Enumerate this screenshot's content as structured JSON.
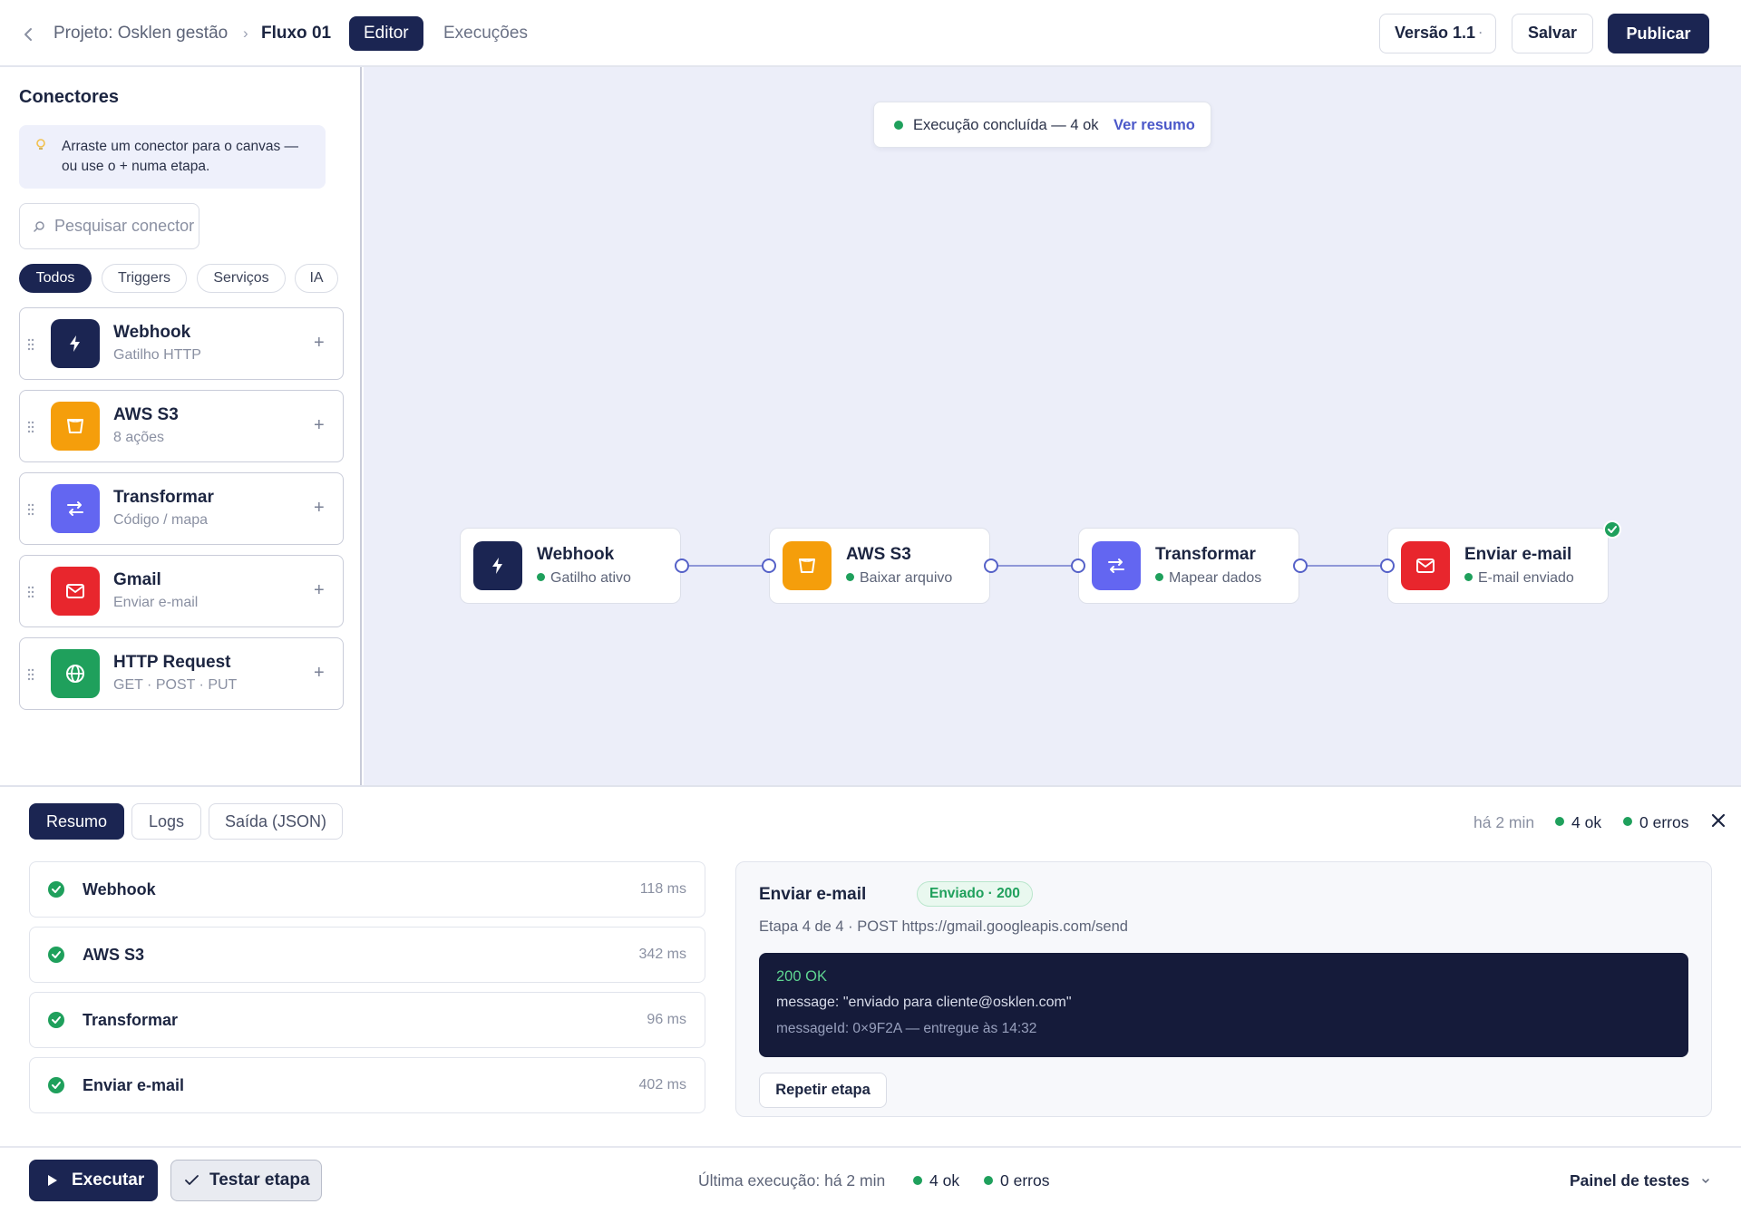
{
  "topbar": {
    "breadcrumb_project": "Projeto: Osklen gestão",
    "breadcrumb_current": "Fluxo 01",
    "tabs": [
      "Editor",
      "Execuções"
    ],
    "version_label": "Versão 1.1",
    "save_label": "Salvar",
    "publish_label": "Publicar"
  },
  "sidebar": {
    "title": "Conectores",
    "hint": "Arraste um conector para o canvas — ou use o + numa etapa.",
    "search_placeholder": "Pesquisar conector",
    "filters": [
      "Todos",
      "Triggers",
      "Serviços",
      "IA"
    ],
    "connectors": [
      {
        "name": "Webhook",
        "sub": "Gatilho HTTP",
        "icon": "bolt-icon",
        "color": "#1b2552"
      },
      {
        "name": "AWS S3",
        "sub": "8 ações",
        "icon": "bucket-icon",
        "color": "#f59e0b"
      },
      {
        "name": "Transformar",
        "sub": "Código / mapa",
        "icon": "transform-icon",
        "color": "#6366f1"
      },
      {
        "name": "Gmail",
        "sub": "Enviar e-mail",
        "icon": "mail-icon",
        "color": "#e8262d"
      },
      {
        "name": "HTTP Request",
        "sub": "GET · POST · PUT",
        "icon": "globe-icon",
        "color": "#1fa05c"
      }
    ]
  },
  "canvas": {
    "toast_text": "Execução concluída — 4 ok",
    "toast_link": "Ver resumo",
    "nodes": [
      {
        "title": "Webhook",
        "status": "Gatilho ativo",
        "icon": "bolt-icon"
      },
      {
        "title": "AWS S3",
        "status": "Baixar arquivo",
        "icon": "bucket-icon"
      },
      {
        "title": "Transformar",
        "status": "Mapear dados",
        "icon": "transform-icon"
      },
      {
        "title": "Enviar e-mail",
        "status": "E-mail enviado",
        "icon": "mail-icon"
      }
    ]
  },
  "panel": {
    "tabs": [
      "Resumo",
      "Logs",
      "Saída (JSON)"
    ],
    "time_ago": "há 2 min",
    "ok_count": "4 ok",
    "error_count": "0 erros",
    "steps": [
      {
        "name": "Webhook",
        "time": "118 ms"
      },
      {
        "name": "AWS S3",
        "time": "342 ms"
      },
      {
        "name": "Transformar",
        "time": "96 ms"
      },
      {
        "name": "Enviar e-mail",
        "time": "402 ms"
      }
    ],
    "detail": {
      "title": "Enviar e-mail",
      "badge": "Enviado · 200",
      "subtitle": "Etapa 4 de 4 · POST https://gmail.googleapis.com/send",
      "code_status": "200 OK",
      "code_message": "message: \"enviado para cliente@osklen.com\"",
      "code_meta": "messageId: 0×9F2A — entregue às 14:32",
      "retry_label": "Repetir etapa"
    }
  },
  "footer": {
    "run_label": "Executar",
    "test_label": "Testar etapa",
    "last_run": "Última execução: há 2 min",
    "ok_count": "4 ok",
    "error_count": "0 erros",
    "panel_link": "Painel de testes"
  },
  "colors": {
    "navy": "#1b2552",
    "success": "#1fa05c",
    "canvas_bg": "#eceef9",
    "accent_link": "#4b58c9"
  }
}
